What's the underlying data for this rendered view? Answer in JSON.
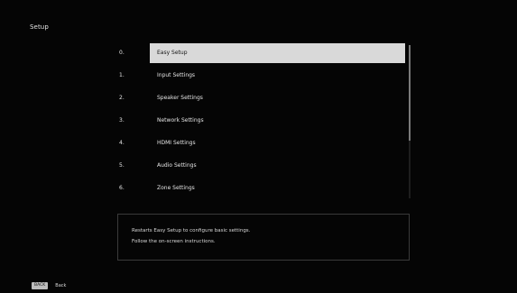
{
  "screen": {
    "title": "Setup"
  },
  "menu": {
    "items": [
      {
        "num": "0.",
        "label": "Easy Setup",
        "selected": true
      },
      {
        "num": "1.",
        "label": "Input Settings",
        "selected": false
      },
      {
        "num": "2.",
        "label": "Speaker Settings",
        "selected": false
      },
      {
        "num": "3.",
        "label": "Network Settings",
        "selected": false
      },
      {
        "num": "4.",
        "label": "HDMI Settings",
        "selected": false
      },
      {
        "num": "5.",
        "label": "Audio Settings",
        "selected": false
      },
      {
        "num": "6.",
        "label": "Zone Settings",
        "selected": false
      }
    ]
  },
  "description": {
    "line1": "Restarts Easy Setup to configure basic settings.",
    "line2": "Follow the on-screen instructions."
  },
  "footer": {
    "back_button": "BACK",
    "back_label": "Back"
  },
  "colors": {
    "background": "#000000",
    "highlight": "#d9d9d9"
  }
}
